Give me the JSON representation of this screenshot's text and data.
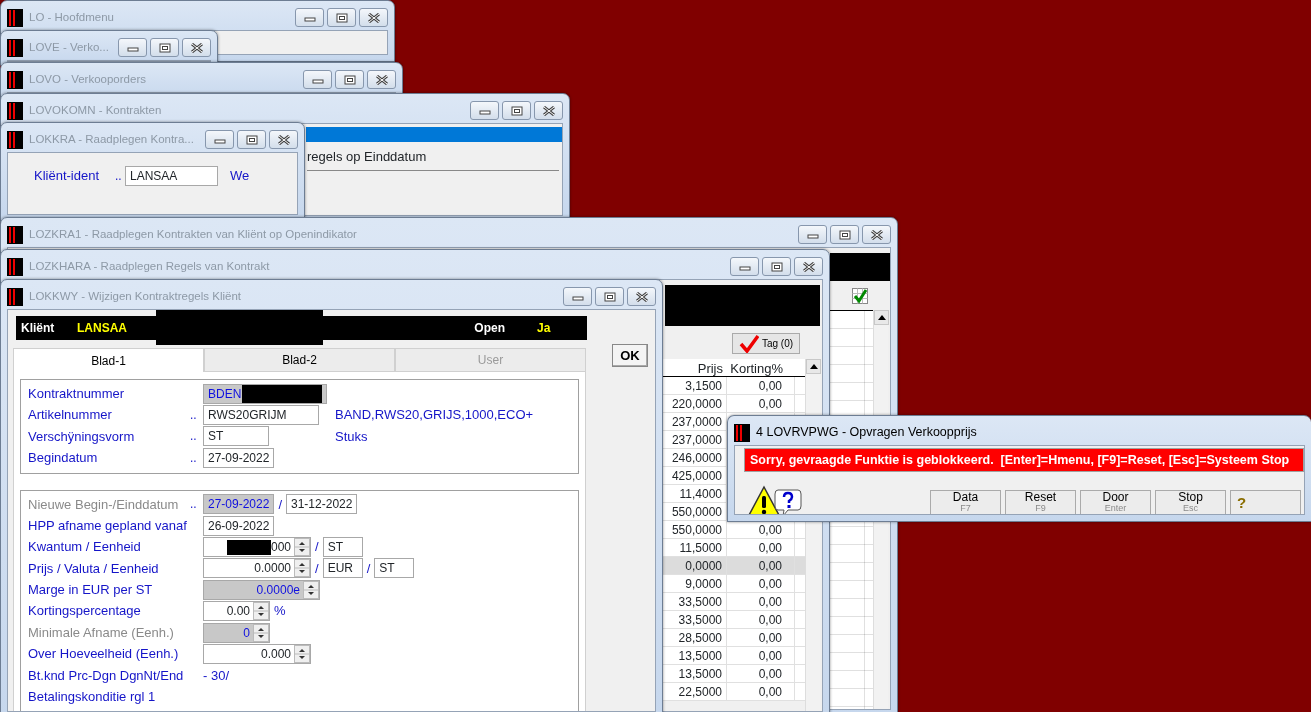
{
  "windows": [
    {
      "title": "LO - Hoofdmenu",
      "active": false,
      "kind": "plain"
    },
    {
      "title": "LOVE - Verko...",
      "active": false,
      "kind": "plain"
    },
    {
      "title": "LOVO - Verkooporders",
      "active": false,
      "kind": "plain"
    },
    {
      "title": "LOVOKOMN - Kontrakten",
      "active": false,
      "kind": "contracts",
      "text": "regels op Einddatum"
    },
    {
      "title": "LOKKRA - Raadplegen Kontra...",
      "active": false,
      "kind": "lookup",
      "label": "Kliënt-ident",
      "dots": "..",
      "value": "LANSAA",
      "trailing": "We"
    },
    {
      "title": "LOZKRA1 - Raadplegen Kontrakten van Kliënt op Openindikator",
      "active": false,
      "kind": "grid"
    },
    {
      "title": "LOZKHARA - Raadplegen Regels van Kontrakt",
      "active": false,
      "kind": "lines",
      "tag_button": "Tag (0)",
      "columns": [
        "Prijs",
        "Korting%"
      ],
      "rows": [
        {
          "prijs": "3,1500",
          "korting": "0,00",
          "selected": false
        },
        {
          "prijs": "220,0000",
          "korting": "0,00",
          "selected": false
        },
        {
          "prijs": "237,0000",
          "selected": false
        },
        {
          "prijs": "237,0000",
          "selected": false
        },
        {
          "prijs": "246,0000",
          "selected": false
        },
        {
          "prijs": "425,0000",
          "selected": false
        },
        {
          "prijs": "11,4000",
          "selected": false
        },
        {
          "prijs": "550,0000",
          "selected": false
        },
        {
          "prijs": "550,0000",
          "korting": "0,00",
          "selected": false
        },
        {
          "prijs": "11,5000",
          "korting": "0,00",
          "selected": false
        },
        {
          "prijs": "0,0000",
          "korting": "0,00",
          "selected": true
        },
        {
          "prijs": "9,0000",
          "korting": "0,00",
          "selected": false
        },
        {
          "prijs": "33,5000",
          "korting": "0,00",
          "selected": false
        },
        {
          "prijs": "33,5000",
          "korting": "0,00",
          "selected": false
        },
        {
          "prijs": "28,5000",
          "korting": "0,00",
          "selected": false
        },
        {
          "prijs": "13,5000",
          "korting": "0,00",
          "selected": false
        },
        {
          "prijs": "13,5000",
          "korting": "0,00",
          "selected": false
        },
        {
          "prijs": "22,5000",
          "korting": "0,00",
          "selected": false
        }
      ]
    },
    {
      "title": "LOKKWY - Wijzigen Kontraktregels Kliënt",
      "active": false,
      "kind": "edit",
      "header": {
        "client_label": "Kliënt",
        "client": "LANSAA",
        "redacted": true,
        "open_label": "Open",
        "open": "Ja"
      },
      "tabs": [
        {
          "label": "Blad-1",
          "selected": true,
          "disabled": false
        },
        {
          "label": "Blad-2",
          "selected": false,
          "disabled": false
        },
        {
          "label": "User",
          "selected": false,
          "disabled": true
        }
      ],
      "ok_button": "OK",
      "groups": [
        [
          {
            "label": "Kontraktnummer",
            "dimmed": false,
            "parts": [
              {
                "kind": "field",
                "value": "BDEN",
                "disabled": true,
                "redacted": true
              }
            ]
          },
          {
            "label": "Artikelnummer",
            "dimmed": false,
            "dots": "..",
            "parts": [
              {
                "kind": "field",
                "value": "RWS20GRIJM",
                "disabled": false
              },
              {
                "kind": "info",
                "text": "BAND,RWS20,GRIJS,1000,ECO+"
              }
            ]
          },
          {
            "label": "Verschÿningsvorm",
            "dimmed": false,
            "dots": "..",
            "parts": [
              {
                "kind": "field",
                "value": "ST",
                "disabled": false
              },
              {
                "kind": "info",
                "text": "Stuks"
              }
            ]
          },
          {
            "label": "Begindatum",
            "dimmed": false,
            "dots": "..",
            "parts": [
              {
                "kind": "field",
                "value": "27-09-2022",
                "disabled": false
              }
            ]
          }
        ],
        [
          {
            "label": "Nieuwe Begin-/Einddatum",
            "dimmed": true,
            "dots": "..",
            "parts": [
              {
                "kind": "field",
                "value": "27-09-2022",
                "disabled": true
              },
              {
                "kind": "sep",
                "text": "/"
              },
              {
                "kind": "field",
                "value": "31-12-2022",
                "disabled": false
              }
            ]
          },
          {
            "label": "HPP afname gepland vanaf",
            "dimmed": false,
            "parts": [
              {
                "kind": "field",
                "value": "26-09-2022",
                "disabled": false
              }
            ]
          },
          {
            "label": "Kwantum / Eenheid",
            "dimmed": false,
            "parts": [
              {
                "kind": "field",
                "value": "000",
                "disabled": false,
                "redacted": true,
                "spin": true
              },
              {
                "kind": "sep",
                "text": "/"
              },
              {
                "kind": "field",
                "value": "ST",
                "disabled": false
              }
            ]
          },
          {
            "label": "Prijs / Valuta / Eenheid",
            "dimmed": false,
            "parts": [
              {
                "kind": "field",
                "value": "0.0000",
                "disabled": false,
                "spin": true
              },
              {
                "kind": "sep",
                "text": "/"
              },
              {
                "kind": "field",
                "value": "EUR",
                "disabled": false
              },
              {
                "kind": "sep",
                "text": "/"
              },
              {
                "kind": "field",
                "value": "ST",
                "disabled": false
              }
            ]
          },
          {
            "label": "Marge in EUR per ST",
            "dimmed": false,
            "parts": [
              {
                "kind": "field",
                "value": "0.0000e",
                "disabled": true,
                "spin": true
              }
            ]
          },
          {
            "label": "Kortingspercentage",
            "dimmed": false,
            "parts": [
              {
                "kind": "field",
                "value": "0.00",
                "disabled": false,
                "spin": true
              },
              {
                "kind": "sep",
                "text": "%"
              }
            ]
          },
          {
            "label": "Minimale Afname (Eenh.)",
            "dimmed": true,
            "parts": [
              {
                "kind": "field",
                "value": "0",
                "disabled": true,
                "spin": true
              }
            ]
          },
          {
            "label": "Over Hoeveelheid (Eenh.)",
            "dimmed": false,
            "parts": [
              {
                "kind": "field",
                "value": "0.000",
                "disabled": false,
                "spin": true
              }
            ]
          },
          {
            "label": "Bt.knd Prc-Dgn DgnNt/End",
            "dimmed": false,
            "parts": [
              {
                "kind": "value",
                "text": "- 30/"
              }
            ]
          },
          {
            "label": "Betalingskonditie rgl 1",
            "dimmed": false
          }
        ]
      ]
    },
    {
      "title": "4 LOVRVPWG - Opvragen Verkoopprijs",
      "active": true,
      "kind": "message",
      "message": "Sorry, gevraagde Funktie is geblokkeerd.  [Enter]=Hmenu, [F9]=Reset, [Esc]=Systeem Stop",
      "buttons": [
        {
          "label": "Data",
          "key": "F7"
        },
        {
          "label": "Reset",
          "key": "F9"
        },
        {
          "label": "Door",
          "key": "Enter"
        },
        {
          "label": "Stop",
          "key": "Esc"
        },
        {
          "label": "?"
        }
      ]
    }
  ]
}
